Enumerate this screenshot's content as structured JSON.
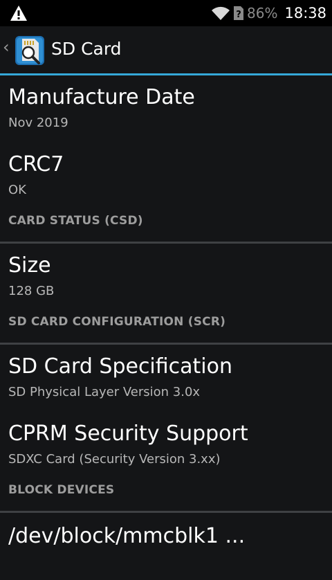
{
  "status_bar": {
    "battery": "86%",
    "time": "18:38",
    "icons": [
      "warning-icon",
      "wifi-icon",
      "no-sim-icon"
    ]
  },
  "action_bar": {
    "title": "SD Card",
    "up_icon": "chevron-left-icon",
    "app_icon": "sd-card-magnifier-icon",
    "accent_color": "#35a8d9"
  },
  "sections": [
    {
      "items": [
        {
          "title": "Manufacture Date",
          "value": "Nov 2019"
        },
        {
          "title": "CRC7",
          "value": "OK"
        }
      ]
    },
    {
      "header": "CARD STATUS (CSD)",
      "items": [
        {
          "title": "Size",
          "value": "128 GB"
        }
      ]
    },
    {
      "header": "SD CARD CONFIGURATION (SCR)",
      "items": [
        {
          "title": "SD Card Specification",
          "value": "SD Physical Layer Version 3.0x"
        },
        {
          "title": "CPRM Security Support",
          "value": "SDXC Card (Security Version 3.xx)"
        }
      ]
    },
    {
      "header": "BLOCK DEVICES",
      "items": [
        {
          "title": "/dev/block/mmcblk1 ..."
        }
      ]
    }
  ]
}
